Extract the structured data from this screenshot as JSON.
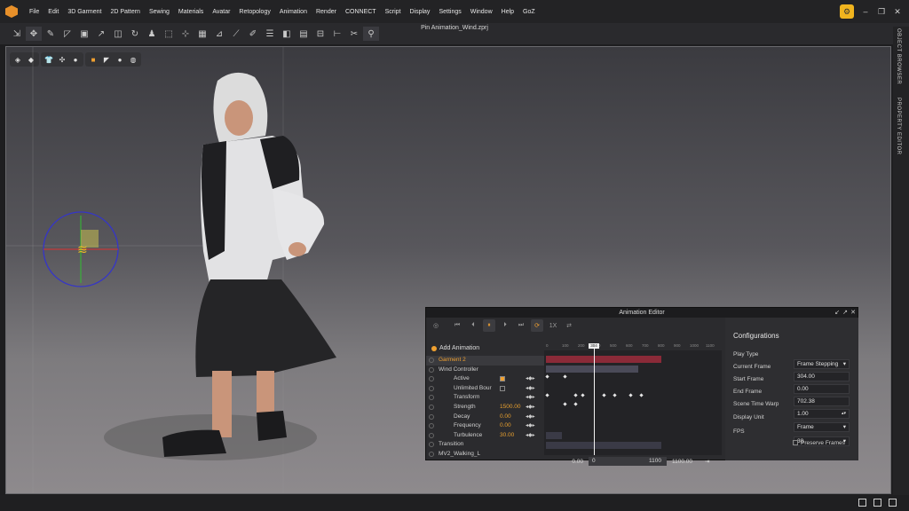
{
  "menu": {
    "items": [
      "File",
      "Edit",
      "3D Garment",
      "2D Pattern",
      "Sewing",
      "Materials",
      "Avatar",
      "Retopology",
      "Animation",
      "Render",
      "CONNECT",
      "Script",
      "Display",
      "Settings",
      "Window",
      "Help",
      "GoZ"
    ]
  },
  "document": {
    "title": "Pin Animation_Wind.zprj"
  },
  "side_tabs": {
    "object_browser": "OBJECT BROWSER",
    "property_editor": "PROPERTY EDITOR"
  },
  "animation_editor": {
    "title": "Animation Editor",
    "speed": "1X",
    "add_animation": "Add Animation",
    "tree": [
      {
        "label": "Garment 2",
        "indent": 1,
        "highlight": true
      },
      {
        "label": "Wind Controller",
        "indent": 1
      },
      {
        "label": "Active",
        "indent": 2,
        "checkbox": true,
        "checked": true
      },
      {
        "label": "Unlimited Bour",
        "indent": 2,
        "checkbox": true,
        "checked": false
      },
      {
        "label": "Transform",
        "indent": 2
      },
      {
        "label": "Strength",
        "indent": 2,
        "value": "1500.00"
      },
      {
        "label": "Decay",
        "indent": 2,
        "value": "0.00"
      },
      {
        "label": "Frequency",
        "indent": 2,
        "value": "0.00"
      },
      {
        "label": "Turbulence",
        "indent": 2,
        "value": "30.00"
      },
      {
        "label": "Transition",
        "indent": 1
      },
      {
        "label": "MV2_Walking_L",
        "indent": 1
      }
    ],
    "ruler_ticks": [
      "0",
      "100",
      "200",
      "304",
      "400",
      "500",
      "600",
      "700",
      "800",
      "900",
      "1000",
      "1100"
    ],
    "playhead_frame": "304",
    "range": {
      "start": "0.00",
      "slider_start": "0",
      "slider_end": "1100",
      "end": "1100.00"
    },
    "config": {
      "title": "Configurations",
      "play_type_label": "Play Type",
      "play_type": "Frame Stepping",
      "current_frame_label": "Current Frame",
      "current_frame": "304.00",
      "start_frame_label": "Start Frame",
      "start_frame": "0.00",
      "end_frame_label": "End Frame",
      "end_frame": "702.38",
      "scene_time_warp_label": "Scene Time Warp",
      "scene_time_warp": "1.00",
      "display_unit_label": "Display Unit",
      "display_unit": "Frame",
      "fps_label": "FPS",
      "fps": "30",
      "preserve_frames": "Preserve Frames"
    }
  },
  "colors": {
    "accent": "#f0a030",
    "garment_bar": "#8a2a38",
    "controller_bar": "#4a4a58"
  }
}
